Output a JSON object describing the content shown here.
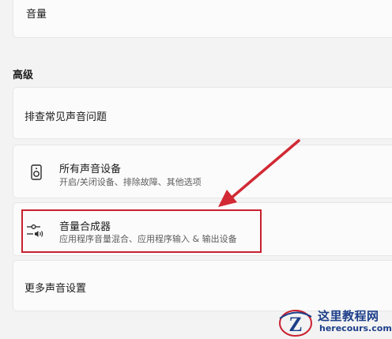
{
  "volume": {
    "label": "音量"
  },
  "advanced": {
    "header": "高级",
    "items": [
      {
        "title": "排查常见声音问题"
      },
      {
        "title": "所有声音设备",
        "subtitle": "开启/关闭设备、排除故障、其他选项",
        "icon": "speaker-device-icon"
      },
      {
        "title": "音量合成器",
        "subtitle": "应用程序音量混合、应用程序输入 & 输出设备",
        "icon": "volume-mixer-icon"
      },
      {
        "title": "更多声音设置"
      }
    ]
  },
  "annotation": {
    "arrow_color": "#d12a35",
    "highlight_color": "#c8202f"
  },
  "watermark": {
    "title": "这里教程网",
    "url": "herecours.com"
  }
}
